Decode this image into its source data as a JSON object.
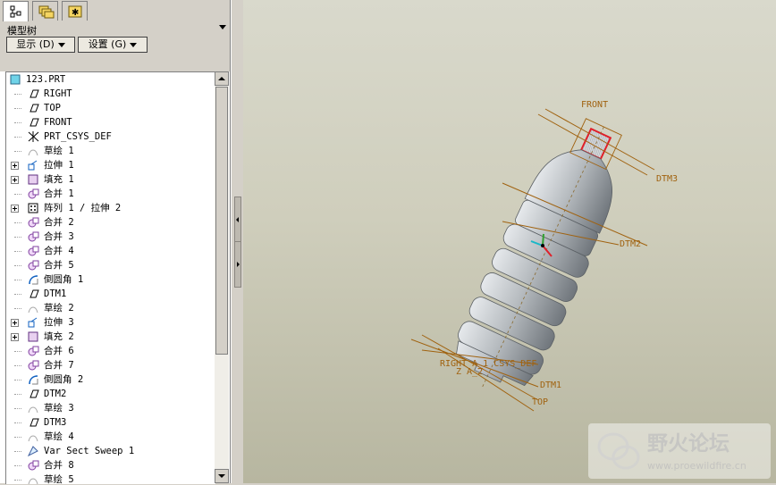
{
  "tabs": [
    {
      "name": "model-tree-tab",
      "icon": "tree-icon"
    },
    {
      "name": "folder-tab",
      "icon": "folders-icon"
    },
    {
      "name": "favorites-tab",
      "icon": "star-icon"
    }
  ],
  "panel": {
    "title": "模型树"
  },
  "buttons": {
    "display": "显示 (D)",
    "settings": "设置 (G)"
  },
  "tree": {
    "root": "123.PRT",
    "items": [
      {
        "label": "RIGHT",
        "icon": "datum-plane-icon",
        "expand": false
      },
      {
        "label": "TOP",
        "icon": "datum-plane-icon",
        "expand": false
      },
      {
        "label": "FRONT",
        "icon": "datum-plane-icon",
        "expand": false
      },
      {
        "label": "PRT_CSYS_DEF",
        "icon": "csys-icon",
        "expand": false
      },
      {
        "label": "草绘 1",
        "icon": "sketch-icon",
        "expand": false
      },
      {
        "label": "拉伸 1",
        "icon": "extrude-icon",
        "expand": true
      },
      {
        "label": "填充 1",
        "icon": "fill-icon",
        "expand": true
      },
      {
        "label": "合并 1",
        "icon": "merge-icon",
        "expand": false
      },
      {
        "label": "阵列 1 / 拉伸 2",
        "icon": "pattern-icon",
        "expand": true
      },
      {
        "label": "合并 2",
        "icon": "merge-icon",
        "expand": false
      },
      {
        "label": "合并 3",
        "icon": "merge-icon",
        "expand": false
      },
      {
        "label": "合并 4",
        "icon": "merge-icon",
        "expand": false
      },
      {
        "label": "合并 5",
        "icon": "merge-icon",
        "expand": false
      },
      {
        "label": "倒圆角 1",
        "icon": "round-icon",
        "expand": false
      },
      {
        "label": "DTM1",
        "icon": "datum-plane-icon",
        "expand": false
      },
      {
        "label": "草绘 2",
        "icon": "sketch-icon",
        "expand": false
      },
      {
        "label": "拉伸 3",
        "icon": "extrude-icon",
        "expand": true
      },
      {
        "label": "填充 2",
        "icon": "fill-icon",
        "expand": true
      },
      {
        "label": "合并 6",
        "icon": "merge-icon",
        "expand": false
      },
      {
        "label": "合并 7",
        "icon": "merge-icon",
        "expand": false
      },
      {
        "label": "倒圆角 2",
        "icon": "round-icon",
        "expand": false
      },
      {
        "label": "DTM2",
        "icon": "datum-plane-icon",
        "expand": false
      },
      {
        "label": "草绘 3",
        "icon": "sketch-icon",
        "expand": false
      },
      {
        "label": "DTM3",
        "icon": "datum-plane-icon",
        "expand": false
      },
      {
        "label": "草绘 4",
        "icon": "sketch-icon",
        "expand": false
      },
      {
        "label": "Var Sect Sweep 1",
        "icon": "sweep-icon",
        "expand": false
      },
      {
        "label": "合并 8",
        "icon": "merge-icon",
        "expand": false
      },
      {
        "label": "草绘 5",
        "icon": "sketch-icon",
        "expand": false
      }
    ]
  },
  "viewport": {
    "datum_labels": {
      "front": "FRONT",
      "dtm3": "DTM3",
      "dtm2": "DTM2",
      "dtm1": "DTM1",
      "top": "TOP",
      "right_csys": "RIGHT A_1 CSYS_DEF",
      "axis_a2": "Z A_2"
    }
  },
  "watermark": {
    "title": "野火论坛",
    "url": "www.proewildfire.cn"
  },
  "colors": {
    "datum": "#a0620f",
    "bottle": "#b7bcc0",
    "highlight": "#e0202a"
  }
}
